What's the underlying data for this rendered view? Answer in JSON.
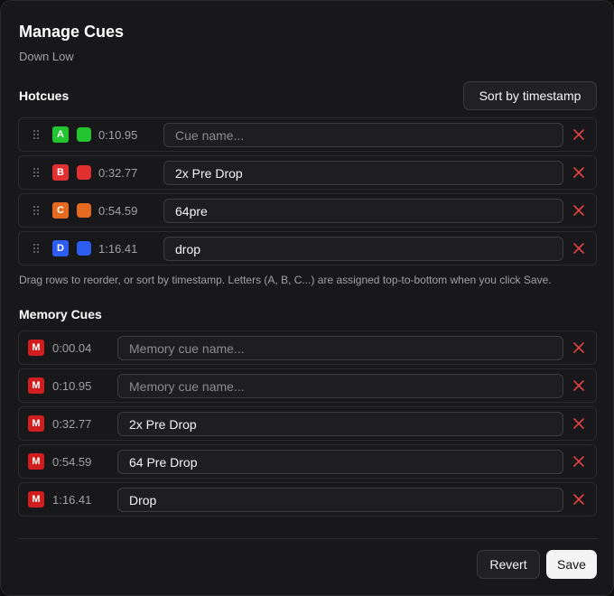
{
  "dialog": {
    "title": "Manage Cues",
    "subtitle": "Down Low"
  },
  "hotcues": {
    "section_title": "Hotcues",
    "sort_label": "Sort by timestamp",
    "items": [
      {
        "letter": "A",
        "color": "#22c52f",
        "time": "0:10.95",
        "name": "",
        "placeholder": "Cue name..."
      },
      {
        "letter": "B",
        "color": "#e0302f",
        "time": "0:32.77",
        "name": "2x Pre Drop",
        "placeholder": "Cue name..."
      },
      {
        "letter": "C",
        "color": "#e46a22",
        "time": "0:54.59",
        "name": "64pre",
        "placeholder": "Cue name..."
      },
      {
        "letter": "D",
        "color": "#2d5cf0",
        "time": "1:16.41",
        "name": "drop",
        "placeholder": "Cue name..."
      }
    ],
    "help": "Drag rows to reorder, or sort by timestamp. Letters (A, B, C...) are assigned top-to-bottom when you click Save."
  },
  "memory_cues": {
    "section_title": "Memory Cues",
    "badge": "M",
    "badge_color": "#d11d1d",
    "items": [
      {
        "time": "0:00.04",
        "name": "",
        "placeholder": "Memory cue name..."
      },
      {
        "time": "0:10.95",
        "name": "",
        "placeholder": "Memory cue name..."
      },
      {
        "time": "0:32.77",
        "name": "2x Pre Drop",
        "placeholder": "Memory cue name..."
      },
      {
        "time": "0:54.59",
        "name": "64 Pre Drop",
        "placeholder": "Memory cue name..."
      },
      {
        "time": "1:16.41",
        "name": "Drop",
        "placeholder": "Memory cue name..."
      }
    ]
  },
  "footer": {
    "revert_label": "Revert",
    "save_label": "Save"
  },
  "icons": {
    "delete": "close-icon",
    "drag": "drag-handle-icon"
  },
  "colors": {
    "delete_icon": "#e04343"
  }
}
